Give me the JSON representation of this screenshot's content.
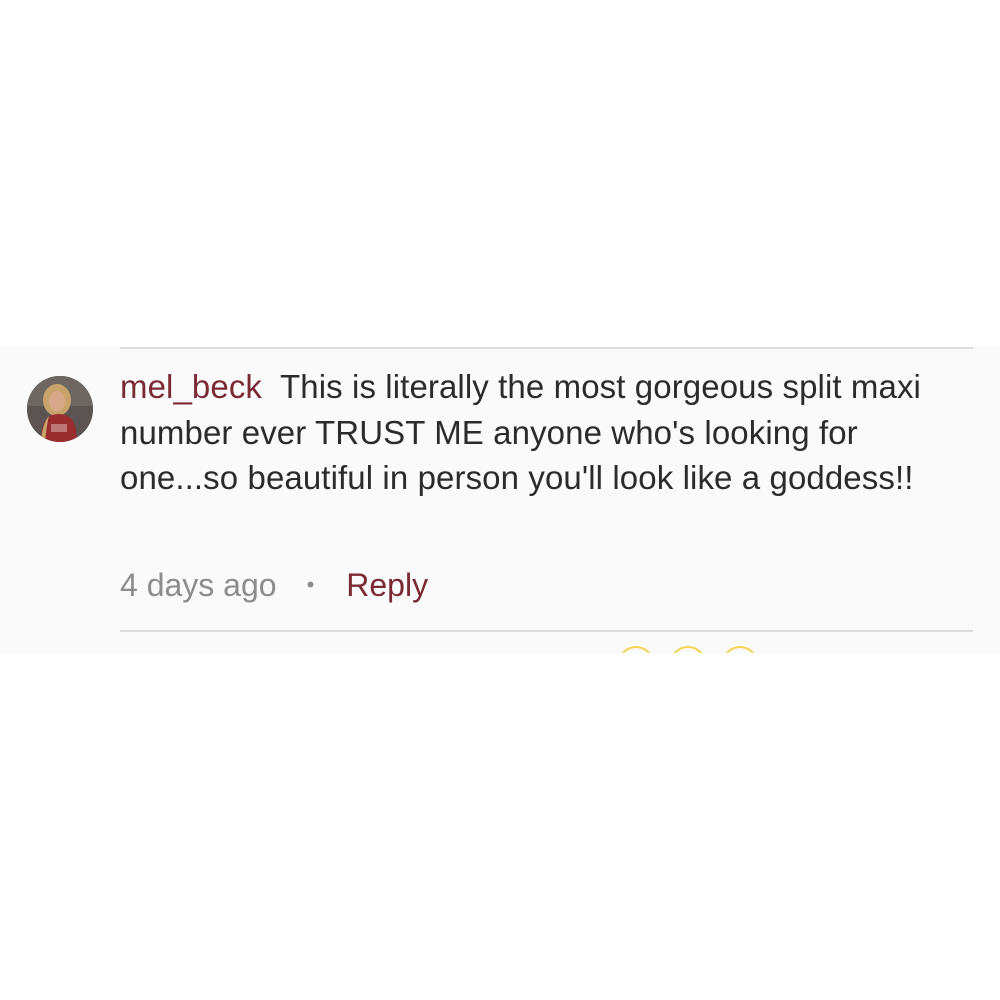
{
  "comment": {
    "username": "mel_beck",
    "text": "This is literally the most gorgeous split maxi number ever TRUST ME anyone who's looking for one...so beautiful in person you'll look like a goddess!!",
    "timestamp": "4 days ago",
    "separator": "•",
    "reply_label": "Reply",
    "avatar": "user-avatar-photo"
  },
  "colors": {
    "username": "#7b2a33",
    "reply": "#7b2a33",
    "body_text": "#2b2b2b",
    "meta_text": "#8c8c8c",
    "card_background": "#fbfafa",
    "divider": "#dcdcdc",
    "next_row_icon_outline": "#f2d34a"
  }
}
